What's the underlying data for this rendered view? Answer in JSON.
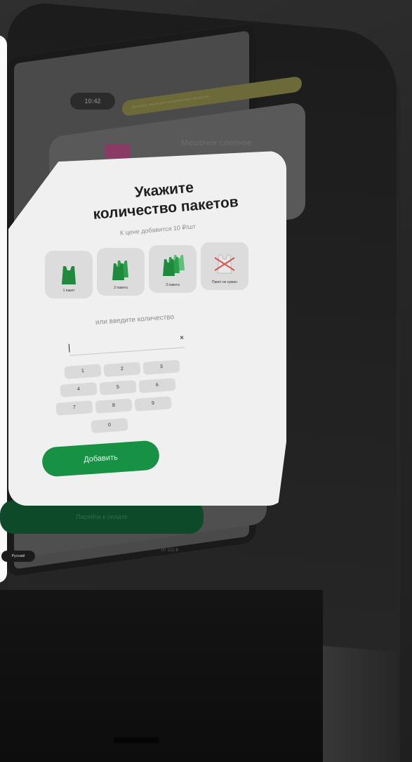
{
  "status_bar": {
    "time": "10:42",
    "banner_text": "Возьмите мешок для замороженных продуктов"
  },
  "background_screen": {
    "product_label": "Мешочек слоеное",
    "proceed_label": "Перейти к оплате",
    "language_label": "Русский",
    "footer_text": "Ит 310 ₽"
  },
  "dialog": {
    "title_line1": "Укажите",
    "title_line2": "количество пакетов",
    "subtitle": "К цене добавится 10 ₽/шт",
    "bag_options": [
      {
        "label": "1 пакет",
        "icon": "bag-1-icon"
      },
      {
        "label": "2 пакета",
        "icon": "bag-2-icon"
      },
      {
        "label": "3 пакета",
        "icon": "bag-3-icon"
      },
      {
        "label": "Пакет не нужен",
        "icon": "no-bag-icon"
      }
    ],
    "or_label": "или введите количество",
    "quantity_value": "",
    "clear_icon": "close-icon",
    "keypad": [
      "1",
      "2",
      "3",
      "4",
      "5",
      "6",
      "7",
      "8",
      "9",
      "0"
    ],
    "add_label": "Добавить"
  },
  "colors": {
    "accent_green": "#179245",
    "bag_green": "#1f8a3e",
    "dialog_bg": "#f0f0f0",
    "no_bag_cross": "#d9534f"
  }
}
